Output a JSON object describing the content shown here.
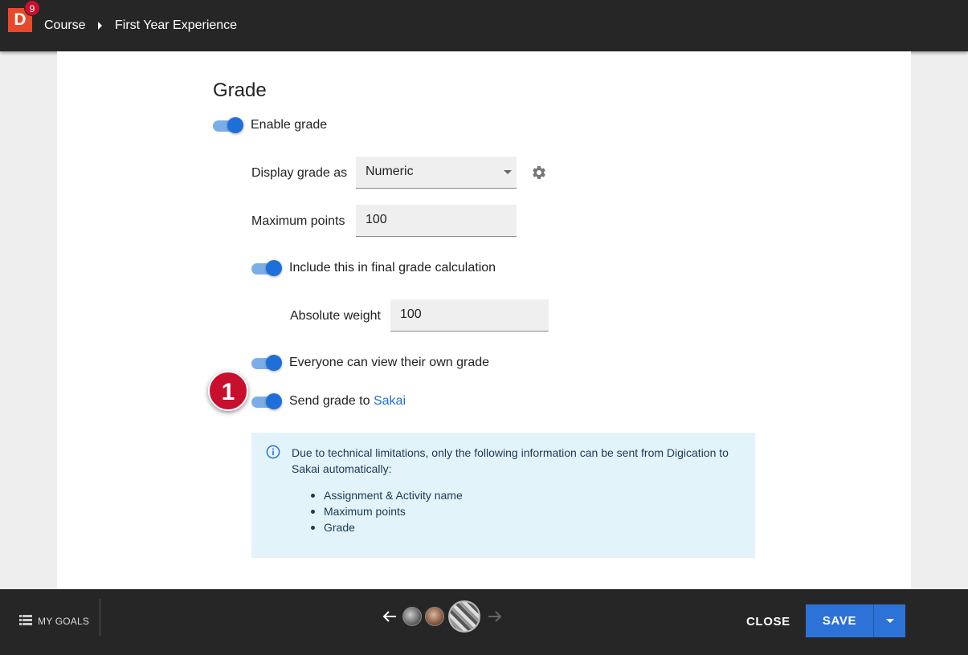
{
  "header": {
    "logo_letter": "D",
    "notification_count": "9",
    "breadcrumb": [
      "Course",
      "First Year Experience"
    ]
  },
  "grade": {
    "title": "Grade",
    "enable_grade": {
      "label": "Enable grade",
      "on": true
    },
    "display_grade_as": {
      "label": "Display grade as",
      "value": "Numeric"
    },
    "maximum_points": {
      "label": "Maximum points",
      "value": "100"
    },
    "include_final": {
      "label": "Include this in final grade calculation",
      "on": true
    },
    "absolute_weight": {
      "label": "Absolute weight",
      "value": "100"
    },
    "everyone_view": {
      "label": "Everyone can view their own grade",
      "on": true
    },
    "send_grade": {
      "label_prefix": "Send grade to ",
      "link": "Sakai",
      "on": true
    },
    "step_marker": "1"
  },
  "info": {
    "text": "Due to technical limitations, only the following information can be sent from Digication to Sakai automatically:",
    "items": [
      "Assignment & Activity name",
      "Maximum points",
      "Grade"
    ]
  },
  "footer": {
    "my_goals": "MY GOALS",
    "close": "CLOSE",
    "save": "SAVE"
  },
  "colors": {
    "accent": "#1e6fd9",
    "brand": "#e8492b",
    "marker": "#c8102e",
    "info_bg": "#e3f3fa"
  }
}
